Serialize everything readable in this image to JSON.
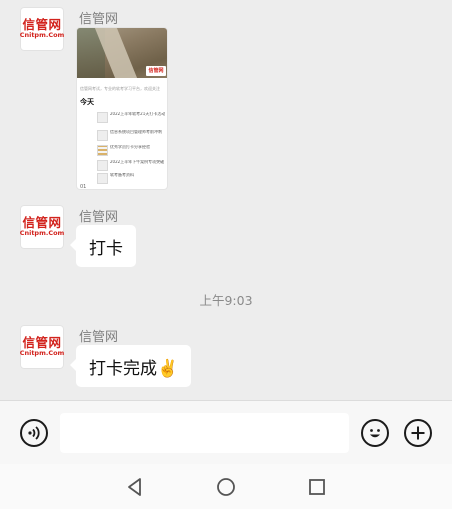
{
  "messages": [
    {
      "sender": "信管网",
      "avatar": {
        "line1": "信管网",
        "line2": "Cnitpm.Com"
      },
      "type": "image",
      "card": {
        "logo_text": "信管网",
        "caption": "信管网考试，专业的软考学习平台，欢迎关注",
        "today": "今天",
        "items": [
          "2022上半年软考21天打卡活动",
          "信息系统项目管理师考前冲刺",
          "优秀学员打卡分享经验",
          "2022上半年下午案例专项突破",
          "软考备考资料"
        ],
        "bottom": "01"
      }
    },
    {
      "sender": "信管网",
      "avatar": {
        "line1": "信管网",
        "line2": "Cnitpm.Com"
      },
      "type": "text",
      "text": "打卡"
    },
    {
      "sender": "信管网",
      "avatar": {
        "line1": "信管网",
        "line2": "Cnitpm.Com"
      },
      "type": "text",
      "text": "打卡完成✌️"
    }
  ],
  "timestamp": "上午9:03",
  "input": {
    "value": "",
    "placeholder": ""
  },
  "icons": {
    "voice": "voice-icon",
    "emoji": "emoji-icon",
    "plus": "plus-icon",
    "back": "nav-back-icon",
    "home": "nav-home-icon",
    "recent": "nav-recent-icon"
  },
  "colors": {
    "brand": "#d2231d",
    "background": "#ededed"
  }
}
